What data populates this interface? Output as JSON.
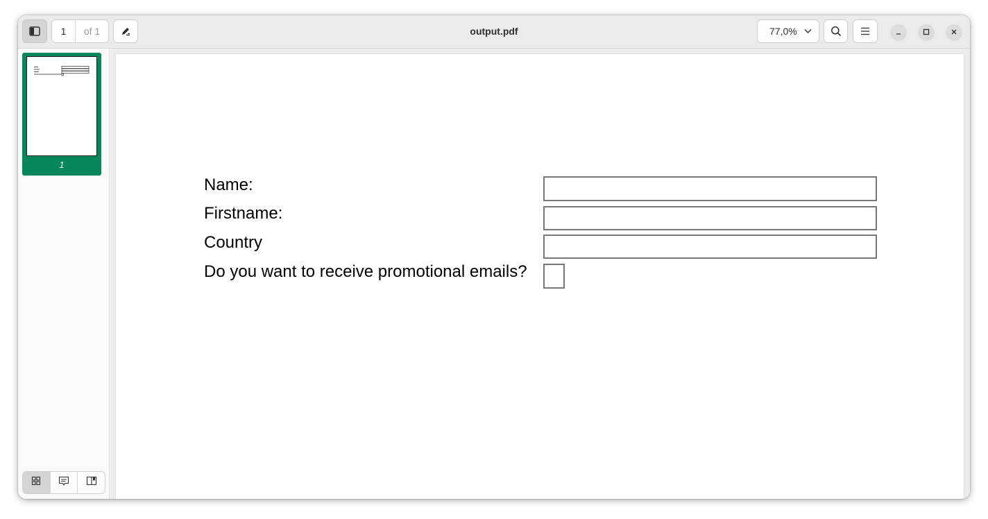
{
  "window": {
    "title": "output.pdf"
  },
  "toolbar": {
    "current_page": "1",
    "total_pages": "of 1",
    "zoom": "77,0%",
    "sidebar_toggle_icon": "sidebar-icon",
    "annotate_icon": "pen-icon",
    "search_icon": "search-icon",
    "menu_icon": "hamburger-icon"
  },
  "sidebar": {
    "thumbnails": [
      {
        "label": "1"
      }
    ],
    "view_modes": [
      "thumbnails-icon",
      "annotations-icon",
      "bookmarks-icon"
    ]
  },
  "document": {
    "labels": {
      "name": "Name:",
      "firstname": "Firstname:",
      "country": "Country",
      "promo": "Do you want to receive promotional emails?"
    }
  },
  "colors": {
    "accent": "#06865b",
    "headerbar": "#ebebeb"
  }
}
